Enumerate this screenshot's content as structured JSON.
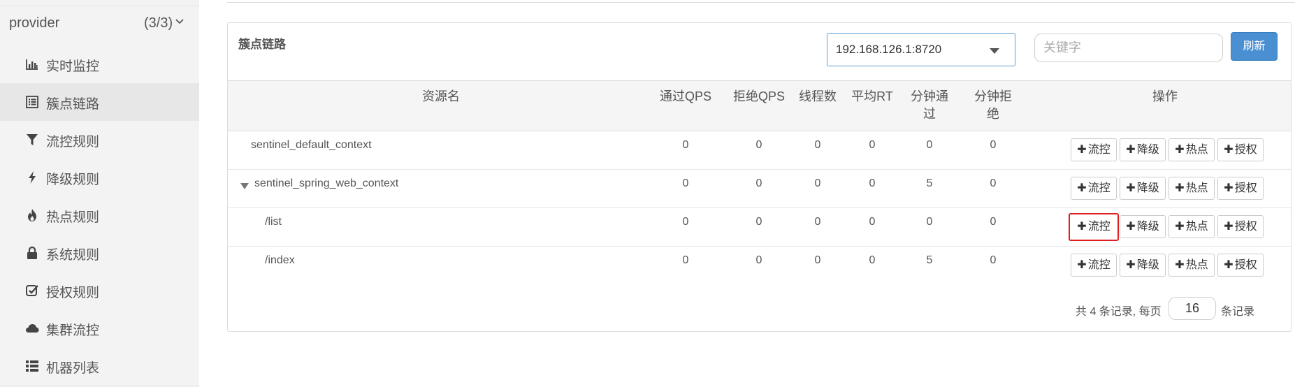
{
  "sidebar": {
    "app_name": "provider",
    "app_count": "(3/3)",
    "items": [
      {
        "label": "实时监控",
        "icon": "bar-chart-icon",
        "active": false
      },
      {
        "label": "簇点链路",
        "icon": "list-icon",
        "active": true
      },
      {
        "label": "流控规则",
        "icon": "filter-icon",
        "active": false
      },
      {
        "label": "降级规则",
        "icon": "flash-icon",
        "active": false
      },
      {
        "label": "热点规则",
        "icon": "fire-icon",
        "active": false
      },
      {
        "label": "系统规则",
        "icon": "lock-icon",
        "active": false
      },
      {
        "label": "授权规则",
        "icon": "check-icon",
        "active": false
      },
      {
        "label": "集群流控",
        "icon": "cloud-icon",
        "active": false
      },
      {
        "label": "机器列表",
        "icon": "th-list-icon",
        "active": false
      }
    ]
  },
  "panel": {
    "title": "簇点链路",
    "machine": "192.168.126.1:8720",
    "search_placeholder": "关键字",
    "refresh_label": "刷新"
  },
  "table": {
    "headers": {
      "name": "资源名",
      "pass_qps": "通过QPS",
      "block_qps": "拒绝QPS",
      "threads": "线程数",
      "avg_rt": "平均RT",
      "min_pass_1": "分钟通",
      "min_pass_2": "过",
      "min_block_1": "分钟拒",
      "min_block_2": "绝",
      "ops": "操作"
    },
    "op_labels": {
      "flow": "流控",
      "degrade": "降级",
      "hotspot": "热点",
      "auth": "授权"
    },
    "rows": [
      {
        "name": "sentinel_default_context",
        "pass_qps": "0",
        "block_qps": "0",
        "threads": "0",
        "avg_rt": "0",
        "min_pass": "0",
        "min_block": "0"
      },
      {
        "name": "sentinel_spring_web_context",
        "pass_qps": "0",
        "block_qps": "0",
        "threads": "0",
        "avg_rt": "0",
        "min_pass": "5",
        "min_block": "0"
      },
      {
        "name": "/list",
        "pass_qps": "0",
        "block_qps": "0",
        "threads": "0",
        "avg_rt": "0",
        "min_pass": "0",
        "min_block": "0"
      },
      {
        "name": "/index",
        "pass_qps": "0",
        "block_qps": "0",
        "threads": "0",
        "avg_rt": "0",
        "min_pass": "5",
        "min_block": "0"
      }
    ]
  },
  "pager": {
    "summary": "共 4 条记录, 每页",
    "page_size": "16",
    "suffix": "条记录"
  },
  "colors": {
    "accent": "#4a8fd1",
    "highlight": "#e02020",
    "sidebar_bg": "#f3f3f3"
  }
}
